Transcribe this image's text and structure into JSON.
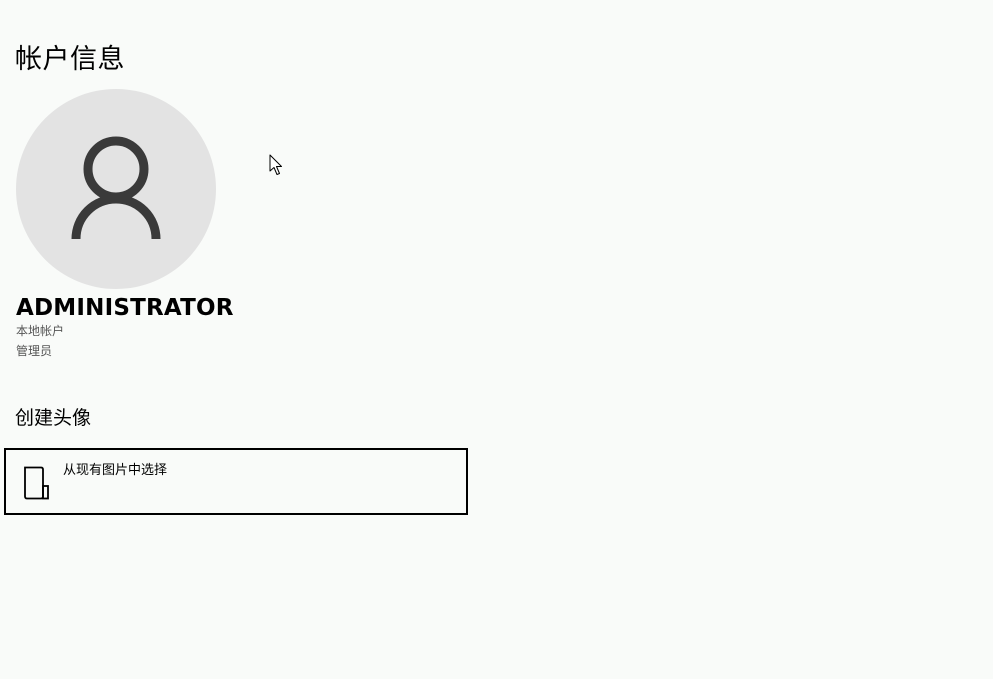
{
  "page": {
    "title": "帐户信息"
  },
  "account": {
    "avatar_icon": "person-icon",
    "name": "ADMINISTRATOR",
    "type": "本地帐户",
    "role": "管理员"
  },
  "create_avatar": {
    "section_title": "创建头像",
    "browse_option": {
      "icon": "folder-browse-icon",
      "label": "从现有图片中选择"
    }
  },
  "colors": {
    "background": "#f9fbf9",
    "avatar_circle": "#e3e3e3",
    "avatar_glyph": "#3a3a3a",
    "border": "#000000"
  }
}
